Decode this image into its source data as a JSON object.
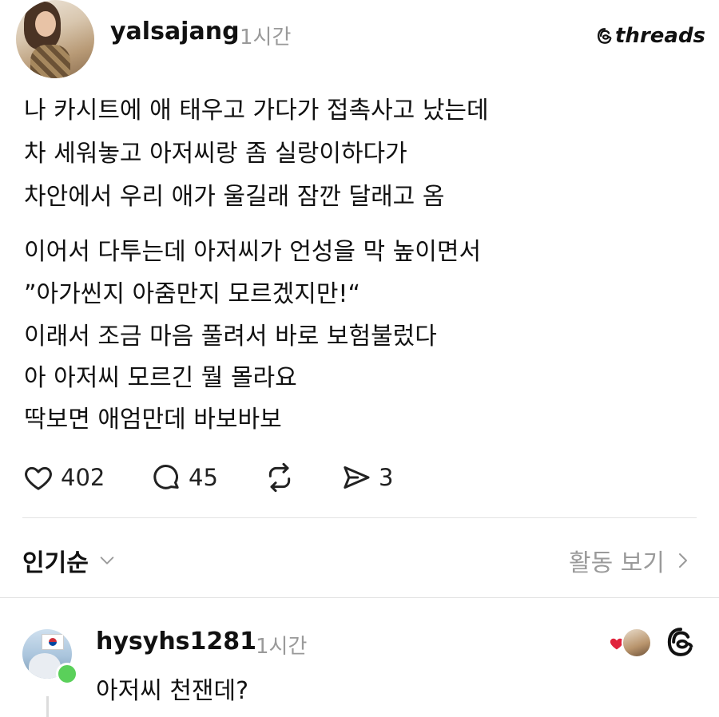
{
  "post": {
    "username": "yalsajang",
    "time": "1시간",
    "brand": "threads",
    "body_lines": [
      "나 카시트에 애 태우고 가다가 접촉사고 났는데",
      "차 세워놓고 아저씨랑 좀 실랑이하다가",
      "차안에서 우리 애가 울길래 잠깐 달래고 옴",
      "이어서 다투는데 아저씨가 언성을 막 높이면서",
      "”아가씬지 아줌만지 모르겠지만!“",
      "이래서 조금 마음 풀려서 바로 보험불렀다",
      "아 아저씨 모르긴 뭘 몰라요",
      "딱보면 애엄만데 바보바보"
    ],
    "actions": {
      "likes": "402",
      "comments": "45",
      "shares": "3"
    }
  },
  "sort": {
    "label": "인기순",
    "activity_label": "활동 보기"
  },
  "reply": {
    "username": "hysyhs1281",
    "time": "1시간",
    "text": "아저씨 천잰데?"
  },
  "colors": {
    "text": "#111111",
    "muted": "#9a9a9a",
    "divider": "#e3e3e3",
    "like_heart": "#e0233c",
    "online": "#5ad05a"
  },
  "icons": [
    "heart-icon",
    "comment-icon",
    "repost-icon",
    "share-icon",
    "chevron-down-icon",
    "chevron-right-icon",
    "threads-logo-icon"
  ]
}
